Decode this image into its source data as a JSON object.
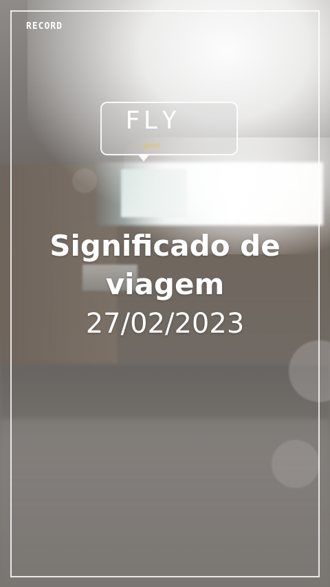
{
  "overlay": {
    "record_label": "RECORD"
  },
  "sticker": {
    "title": "FLY",
    "sub_prefix": "/",
    "sub_text": "good",
    "sub_color": "#e8c441"
  },
  "caption": {
    "title": "Significado de viagem",
    "date": "27/02/2023"
  },
  "colors": {
    "text": "#ffffff",
    "frame_border": "#ffffff"
  }
}
